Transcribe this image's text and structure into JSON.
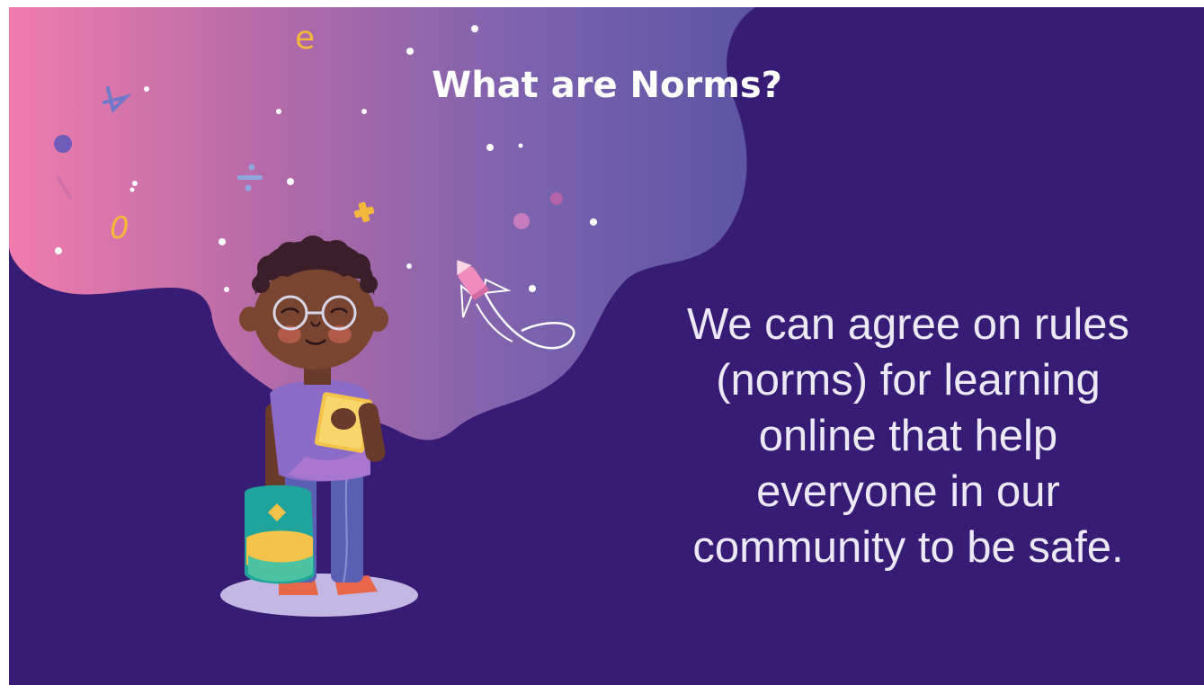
{
  "slide": {
    "title": "What are Norms?",
    "body_lines": [
      "We can agree on rules",
      "(norms) for learning",
      "online that help",
      "everyone in our",
      "community to be safe."
    ]
  },
  "illustration": {
    "subject": "child-with-backpack-and-book-icon",
    "decorations": [
      "pencil-rocket-icon",
      "plus-symbol-icon",
      "divide-symbol-icon",
      "planet-icon"
    ]
  },
  "colors": {
    "background": "#361c75",
    "gradient_start": "#f07cac",
    "gradient_end": "#5e4fa6",
    "text": "#ffffff"
  }
}
